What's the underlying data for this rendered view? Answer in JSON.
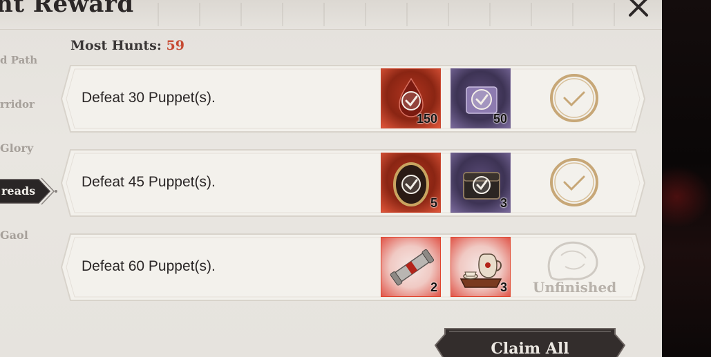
{
  "header": {
    "title": "nt Reward",
    "most_hunts_label": "Most Hunts:",
    "most_hunts_value": "59"
  },
  "sidenav": {
    "items": [
      "d Path",
      "rridor",
      "Glory",
      "reads",
      "Gaol"
    ],
    "active_index": 3
  },
  "tasks": [
    {
      "description": "Defeat 30 Puppet(s).",
      "rewards": [
        {
          "icon": "blood-drop-icon",
          "quantity": "150",
          "rarity": "red"
        },
        {
          "icon": "purple-emblem-icon",
          "quantity": "50",
          "rarity": "purple"
        }
      ],
      "status": "claimed"
    },
    {
      "description": "Defeat 45 Puppet(s).",
      "rewards": [
        {
          "icon": "gold-frame-medallion-icon",
          "quantity": "5",
          "rarity": "red"
        },
        {
          "icon": "dark-chest-icon",
          "quantity": "3",
          "rarity": "purple"
        }
      ],
      "status": "claimed"
    },
    {
      "description": "Defeat 60 Puppet(s).",
      "rewards": [
        {
          "icon": "scroll-icon",
          "quantity": "2",
          "rarity": "red"
        },
        {
          "icon": "tea-set-icon",
          "quantity": "3",
          "rarity": "red"
        }
      ],
      "status": "unfinished",
      "status_label": "Unfinished"
    }
  ],
  "footer": {
    "claim_all_label": "Claim All"
  },
  "colors": {
    "accent_count": "#c74a32",
    "panel_bg": "#e6e3de",
    "text_dark": "#2b2727",
    "reward_red": "#c9452c",
    "reward_purple": "#5a4b77",
    "claimed_gold": "#c7a777"
  }
}
